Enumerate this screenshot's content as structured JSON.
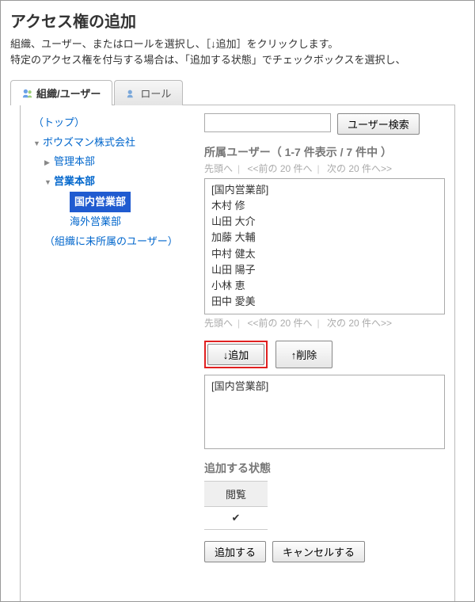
{
  "header": {
    "title": "アクセス権の追加",
    "description_line1": "組織、ユーザー、またはロールを選択し、［↓追加］をクリックします。",
    "description_line2": "特定のアクセス権を付与する場合は、「追加する状態」でチェックボックスを選択し、"
  },
  "tabs": {
    "org_user": "組織/ユーザー",
    "role": "ロール"
  },
  "tree": {
    "top": "（トップ）",
    "company": "ボウズマン株式会社",
    "admin": "管理本部",
    "sales": "営業本部",
    "domestic": "国内営業部",
    "overseas": "海外営業部",
    "unassigned": "（組織に未所属のユーザー）"
  },
  "search": {
    "button": "ユーザー検索",
    "placeholder": ""
  },
  "users_section": {
    "heading": "所属ユーザー（ 1-7 件表示 / 7 件中 ）",
    "pager_first": "先頭へ",
    "pager_prev": "<<前の 20 件へ",
    "pager_next": "次の 20 件へ>>"
  },
  "user_list": {
    "group": "[国内営業部]",
    "u1": "木村 修",
    "u2": "山田 大介",
    "u3": "加藤 大輔",
    "u4": "中村 健太",
    "u5": "山田 陽子",
    "u6": "小林 恵",
    "u7": "田中 愛美"
  },
  "actions": {
    "add": "↓追加",
    "remove": "↑削除"
  },
  "selected": {
    "item1": "[国内営業部]"
  },
  "status": {
    "heading": "追加する状態",
    "col_view": "閲覧",
    "check": "✔"
  },
  "footer": {
    "submit": "追加する",
    "cancel": "キャンセルする"
  }
}
